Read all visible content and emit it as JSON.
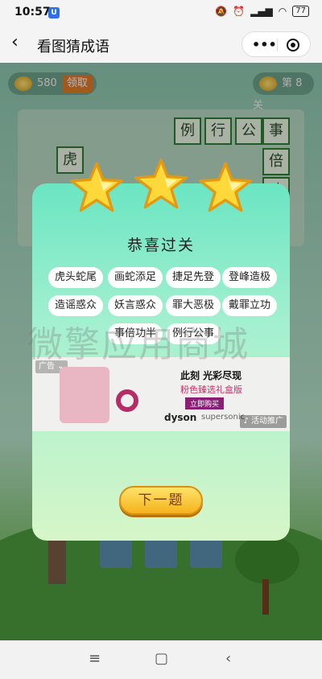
{
  "status": {
    "time": "10:57",
    "app_badge": "U",
    "battery": "77"
  },
  "header": {
    "back": "‹",
    "title": "看图猜成语",
    "more": "•••"
  },
  "game": {
    "coins": "580",
    "claim_label": "领取",
    "level": "第 8 关",
    "grid_chars": [
      "例",
      "行",
      "公",
      "事",
      "虎",
      "倍",
      "功"
    ]
  },
  "modal": {
    "title": "恭喜过关",
    "idioms": [
      "虎头蛇尾",
      "画蛇添足",
      "捷足先登",
      "登峰造极",
      "造谣惑众",
      "妖言惑众",
      "罪大恶极",
      "戴罪立功",
      "事倍功半",
      "例行公事"
    ],
    "next_label": "下一题",
    "ad": {
      "tag": "广告 ⌄",
      "headline": "此刻 光彩尽现",
      "subline": "粉色臻选礼盒版",
      "buy": "立即购买",
      "brand": "dyson",
      "brand_sub": "supersonic",
      "promo": "♪ 活动推广"
    }
  },
  "watermark": "微擎应用商城",
  "navbar": {
    "menu": "≡",
    "home": "▢",
    "back": "‹"
  },
  "colors": {
    "accent": "#f5b21d",
    "modal_top": "#6be5c2",
    "cell_border": "#2e7d32"
  }
}
